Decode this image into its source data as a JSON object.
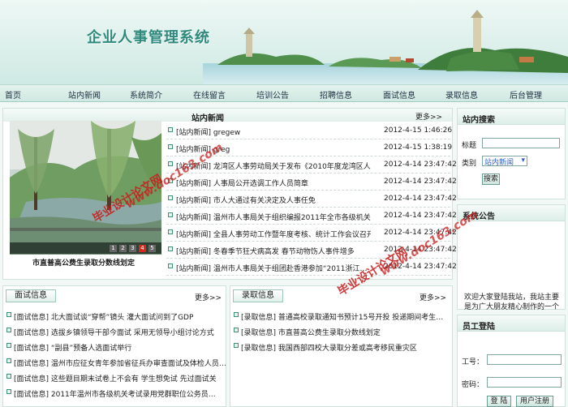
{
  "banner": {
    "title": "企业人事管理系统"
  },
  "nav": [
    {
      "label": "首页"
    },
    {
      "label": "站内新闻"
    },
    {
      "label": "系统简介"
    },
    {
      "label": "在线留言"
    },
    {
      "label": "培训公告"
    },
    {
      "label": "招聘信息"
    },
    {
      "label": "面试信息"
    },
    {
      "label": "录取信息"
    },
    {
      "label": "后台管理"
    }
  ],
  "news": {
    "title": "站内新闻",
    "more": "更多>>",
    "photo_caption": "市直普高公费生录取分数线划定",
    "pages": [
      "1",
      "2",
      "3",
      "4",
      "5"
    ],
    "active_page": "4",
    "items": [
      {
        "title": "[站内新闻] gregew",
        "date": "2012-4-15 1:46:26"
      },
      {
        "title": "[站内新闻] greg",
        "date": "2012-4-15 1:38:19"
      },
      {
        "title": "[站内新闻] 龙湾区人事劳动局关于发布《2010年度龙湾区人…",
        "date": "2012-4-14 23:47:42"
      },
      {
        "title": "[站内新闻] 人事局公开选调工作人员简章",
        "date": "2012-4-14 23:47:42"
      },
      {
        "title": "[站内新闻] 市人大通过有关决定及人事任免",
        "date": "2012-4-14 23:47:42"
      },
      {
        "title": "[站内新闻] 温州市人事局关于组织编报2011年全市各级机关",
        "date": "2012-4-14 23:47:42"
      },
      {
        "title": "[站内新闻] 全县人事劳动工作暨年度考核、统计工作会议召开",
        "date": "2012-4-14 23:47:42"
      },
      {
        "title": "[站内新闻] 冬春季节狂犬病高发 春节动物饬人事件增多",
        "date": "2012-4-14 23:47:42"
      },
      {
        "title": "[站内新闻] 温州市人事局关于组团赴香港参加“2011浙江…",
        "date": "2012-4-14 23:47:42"
      }
    ]
  },
  "search": {
    "title": "站内搜索",
    "keyword_label": "标题",
    "keyword_value": "",
    "category_label": "类别",
    "category_value": "站内新闻",
    "button_label": "搜索"
  },
  "notice": {
    "title": "系统公告",
    "text": "欢迎大家登陆我站，我站主要是为广大朋友精心制作的一个"
  },
  "login": {
    "title": "员工登陆",
    "username_label": "工号：",
    "password_label": "密码：",
    "login_button": "登 陆",
    "register_button": "用户注册"
  },
  "interview": {
    "title": "面试信息",
    "more": "更多>>",
    "items": [
      {
        "title": "[面试信息] 北大面试谈“穿帮”镜头 灌大面试问到了GDP"
      },
      {
        "title": "[面试信息] 选拔乡镇领导干部今面试 采用无领导小组讨论方式"
      },
      {
        "title": "[面试信息] “副县”预备人选面试举行"
      },
      {
        "title": "[面试信息] 温州市应征女青年参加省征兵办审查面试及体检人员…"
      },
      {
        "title": "[面试信息] 这些题目期末试卷上不会有 学生想免试 先过面试关"
      },
      {
        "title": "[面试信息] 2011年温州市各级机关考试录用党群职位公务员…"
      }
    ]
  },
  "admission": {
    "title": "录取信息",
    "more": "更多>>",
    "items": [
      {
        "title": "[录取信息] 普通高校录取通知书预计15号开投 投递期间考生…"
      },
      {
        "title": "[录取信息] 市直普高公费生录取分数线划定"
      },
      {
        "title": "[录取信息] 我国西部四校大录取分差或高考移民重灾区"
      }
    ]
  },
  "watermark": {
    "site": "www.doc163.com",
    "label": "毕业设计论文网"
  },
  "colors": {
    "accent": "#2e8a7d",
    "nav_bg": "#d6ece6",
    "watermark": "#c81e1e"
  }
}
